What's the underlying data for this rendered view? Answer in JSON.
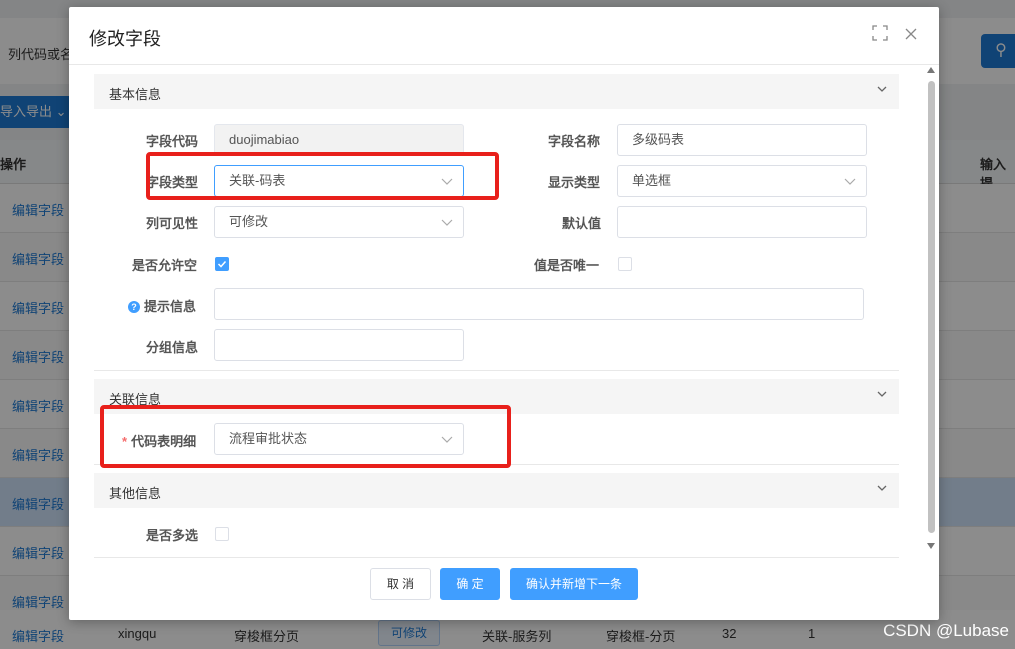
{
  "background": {
    "search_label": "列代码或名",
    "import_label": "导入导出 ⌄",
    "col_operation": "操作",
    "col_input": "输入提",
    "row_link": "编辑字段",
    "last_row": {
      "code": "xingqu",
      "type": "穿梭框分页",
      "visible": "可修改",
      "field_type": "关联-服务列",
      "display": "穿梭框-分页",
      "width": "32",
      "order": "1"
    },
    "watermark": "CSDN @Lubase"
  },
  "dialog": {
    "title": "修改字段",
    "sections": {
      "basic": "基本信息",
      "relation": "关联信息",
      "other": "其他信息"
    },
    "labels": {
      "field_code": "字段代码",
      "field_name": "字段名称",
      "field_type": "字段类型",
      "display_type": "显示类型",
      "column_visibility": "列可见性",
      "default_value": "默认值",
      "allow_null": "是否允许空",
      "is_unique": "值是否唯一",
      "hint": "提示信息",
      "group": "分组信息",
      "code_table_detail": "代码表明细",
      "multi_select": "是否多选"
    },
    "values": {
      "field_code": "duojimabiao",
      "field_name": "多级码表",
      "field_type": "关联-码表",
      "display_type": "单选框",
      "column_visibility": "可修改",
      "default_value": "",
      "hint": "",
      "group": "",
      "code_table_detail": "流程审批状态"
    },
    "checks": {
      "allow_null": true,
      "is_unique": false,
      "multi_select": false
    },
    "buttons": {
      "cancel": "取 消",
      "ok": "确 定",
      "confirm_next": "确认并新增下一条"
    },
    "required_mark": "*",
    "help_glyph": "?"
  },
  "colors": {
    "primary": "#409eff",
    "highlight_box": "#e8201b"
  }
}
